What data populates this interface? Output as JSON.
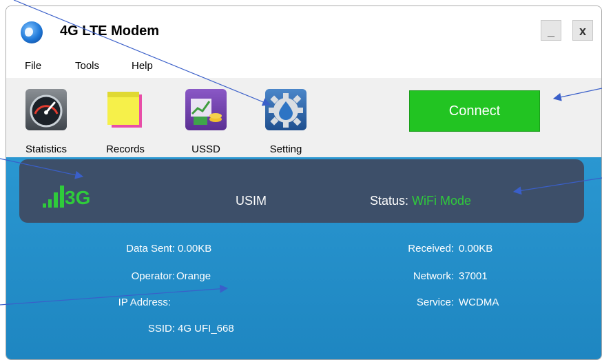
{
  "window": {
    "title": "4G LTE Modem",
    "minimize_label": "_",
    "close_label": "x"
  },
  "menu": {
    "items": [
      "File",
      "Tools",
      "Help"
    ]
  },
  "toolbar": {
    "statistics_label": "Statistics",
    "records_label": "Records",
    "ussd_label": "USSD",
    "setting_label": "Setting",
    "connect_label": "Connect"
  },
  "status": {
    "network_type": "3G",
    "sim": "USIM",
    "status_label": "Status: ",
    "status_value": "WiFi Mode",
    "signal_bars": 4
  },
  "info": {
    "data_sent_label": "Data Sent:",
    "data_sent_value": "0.00KB",
    "received_label": "Received:",
    "received_value": "0.00KB",
    "operator_label": "Operator:",
    "operator_value": "Orange",
    "network_label": "Network:",
    "network_value": "37001",
    "ip_label": "IP Address:",
    "ip_value": "",
    "service_label": "Service:",
    "service_value": "WCDMA",
    "ssid_label": "SSID:",
    "ssid_value": "4G UFI_668"
  },
  "colors": {
    "accent_green": "#2fcb3b",
    "connect_green": "#22c422",
    "panel_dark": "#3d4f69",
    "info_blue": "#2a97d1",
    "annotation_line": "#3a5fc9"
  },
  "icons": [
    "globe-icon",
    "speedometer-icon",
    "sticky-notes-icon",
    "ussd-chart-icon",
    "gear-water-drop-icon",
    "signal-strength-icon"
  ]
}
